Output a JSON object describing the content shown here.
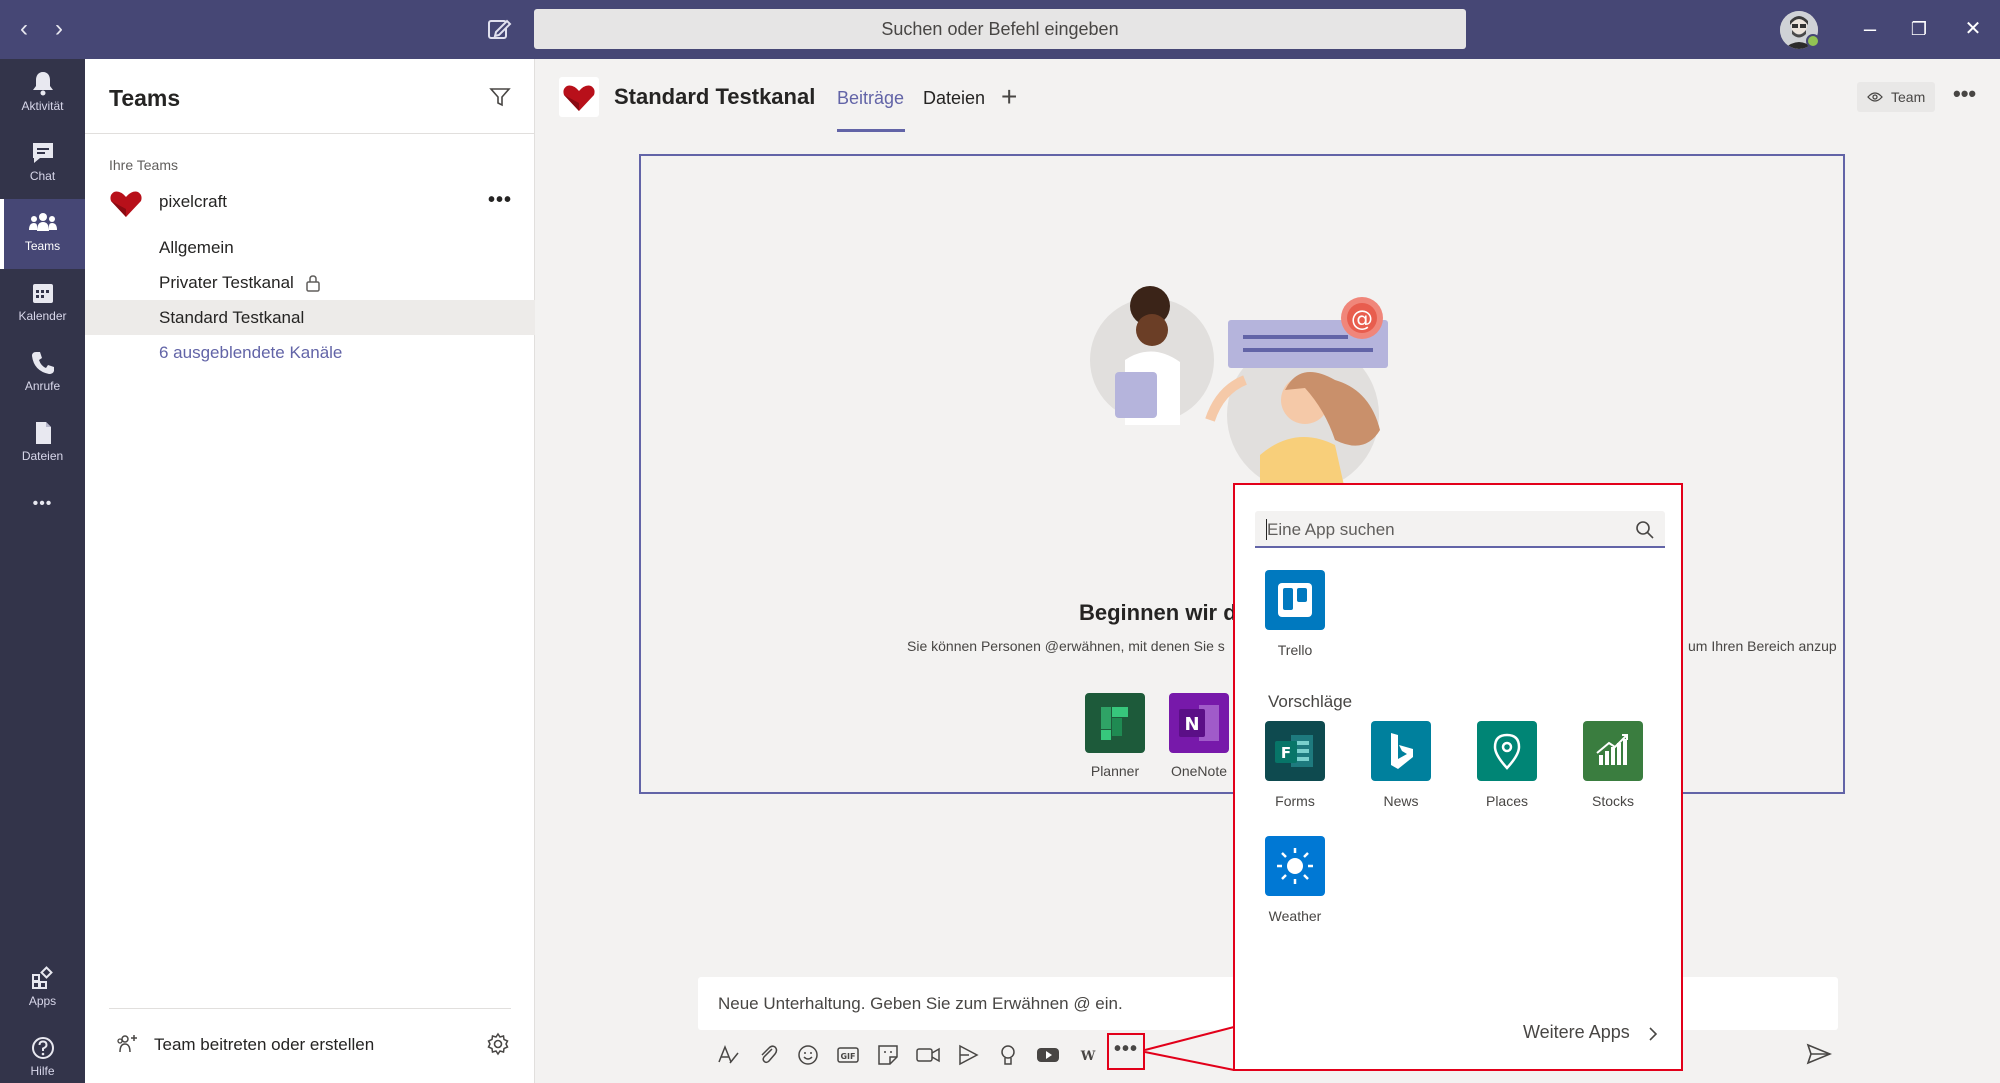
{
  "titlebar": {
    "search_text": "Suchen oder Befehl eingeben",
    "back_glyph": "‹",
    "forward_glyph": "›",
    "minimize_glyph": "–",
    "maximize_glyph": "❐",
    "close_glyph": "✕",
    "status_color": "#92c353"
  },
  "rail": {
    "items": [
      {
        "label": "Aktivität",
        "icon": "bell-icon"
      },
      {
        "label": "Chat",
        "icon": "chat-icon"
      },
      {
        "label": "Teams",
        "icon": "teams-icon",
        "active": true
      },
      {
        "label": "Kalender",
        "icon": "calendar-icon"
      },
      {
        "label": "Anrufe",
        "icon": "phone-icon"
      },
      {
        "label": "Dateien",
        "icon": "file-icon"
      }
    ],
    "more_glyph": "•••",
    "bottom": [
      {
        "label": "Apps",
        "icon": "apps-icon"
      },
      {
        "label": "Hilfe",
        "icon": "help-icon"
      }
    ]
  },
  "teampanel": {
    "title": "Teams",
    "section_label": "Ihre Teams",
    "team_name": "pixelcraft",
    "more_glyph": "•••",
    "channels": [
      {
        "label": "Allgemein"
      },
      {
        "label": "Privater Testkanal",
        "private": true
      },
      {
        "label": "Standard Testkanal",
        "active": true
      },
      {
        "label": "6 ausgeblendete Kanäle",
        "link": true
      }
    ],
    "join_label": "Team beitreten oder erstellen"
  },
  "channel_header": {
    "title": "Standard Testkanal",
    "tabs": [
      {
        "label": "Beiträge",
        "active": true
      },
      {
        "label": "Dateien"
      }
    ],
    "add_glyph": "+",
    "team_button": "Team",
    "more_glyph": "•••",
    "accent": "#6264a7"
  },
  "welcome": {
    "title_visible": "Beginnen wir d",
    "subtitle_left": "Sie können Personen @erwähnen, mit denen Sie s",
    "subtitle_right": "um Ihren Bereich anzup",
    "apps": [
      {
        "label": "Planner",
        "color": "#1d5a3a"
      },
      {
        "label": "OneNote",
        "color": "#7719aa"
      }
    ]
  },
  "compose": {
    "placeholder": "Neue Unterhaltung. Geben Sie zum Erwähnen @ ein.",
    "more_glyph": "•••",
    "tools": [
      "format-icon",
      "attach-icon",
      "emoji-icon",
      "gif-icon",
      "sticker-icon",
      "meet-now-icon",
      "stream-icon",
      "praise-icon",
      "youtube-icon",
      "wikipedia-icon"
    ]
  },
  "app_popup": {
    "search_placeholder": "Eine App suchen",
    "pinned": [
      {
        "label": "Trello",
        "color": "#0079bf",
        "icon": "trello-icon"
      }
    ],
    "suggestions_heading": "Vorschläge",
    "suggestions": [
      {
        "label": "Forms",
        "color": "#0e4a4f",
        "icon": "forms-icon"
      },
      {
        "label": "News",
        "color": "#00809d",
        "icon": "bing-icon"
      },
      {
        "label": "Places",
        "color": "#008575",
        "icon": "map-pin-icon"
      },
      {
        "label": "Stocks",
        "color": "#3a7d3f",
        "icon": "chart-icon"
      },
      {
        "label": "Weather",
        "color": "#0078d4",
        "icon": "sun-icon"
      }
    ],
    "more_apps": "Weitere Apps",
    "highlight_color": "#e2001a"
  }
}
